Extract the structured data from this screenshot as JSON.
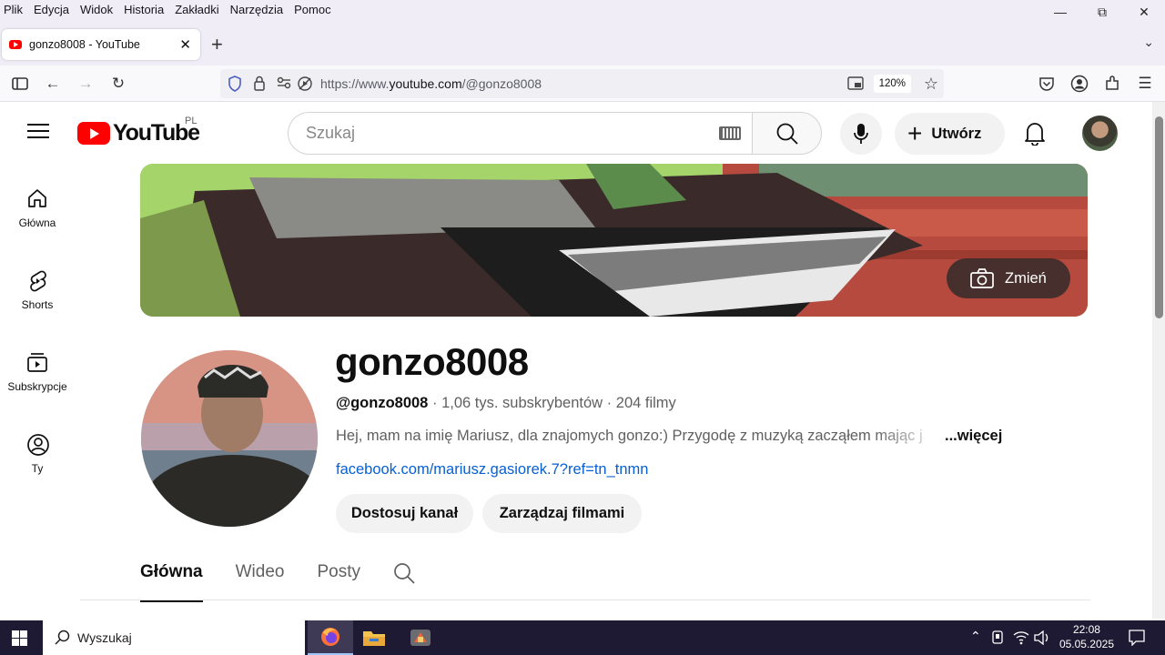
{
  "browser": {
    "menu": [
      "Plik",
      "Edycja",
      "Widok",
      "Historia",
      "Zakładki",
      "Narzędzia",
      "Pomoc"
    ],
    "tab_title": "gonzo8008 - YouTube",
    "url_prefix": "https://www.",
    "url_domain": "youtube.com",
    "url_path": "/@gonzo8008",
    "zoom": "120%"
  },
  "youtube": {
    "logo_text": "YouTube",
    "country_code": "PL",
    "search_placeholder": "Szukaj",
    "create_label": "Utwórz",
    "sidebar": [
      {
        "label": "Główna",
        "icon": "home-icon"
      },
      {
        "label": "Shorts",
        "icon": "shorts-icon"
      },
      {
        "label": "Subskrypcje",
        "icon": "subscriptions-icon"
      },
      {
        "label": "Ty",
        "icon": "you-icon"
      }
    ],
    "banner_change_label": "Zmień"
  },
  "channel": {
    "name": "gonzo8008",
    "handle": "@gonzo8008",
    "subscribers": "1,06 tys. subskrybentów",
    "videos": "204 filmy",
    "description": "Hej, mam na imię Mariusz, dla znajomych gonzo:) Przygodę z muzyką zacząłem mając j",
    "more_label": "...więcej",
    "link": "facebook.com/mariusz.gasiorek.7?ref=tn_tnmn",
    "customize_button": "Dostosuj kanał",
    "manage_button": "Zarządzaj filmami",
    "tabs": [
      "Główna",
      "Wideo",
      "Posty"
    ]
  },
  "taskbar": {
    "search_placeholder": "Wyszukaj",
    "time": "22:08",
    "date": "05.05.2025"
  },
  "colors": {
    "youtube_red": "#ff0000",
    "link_blue": "#065fd4",
    "taskbar": "#1f1a33"
  }
}
